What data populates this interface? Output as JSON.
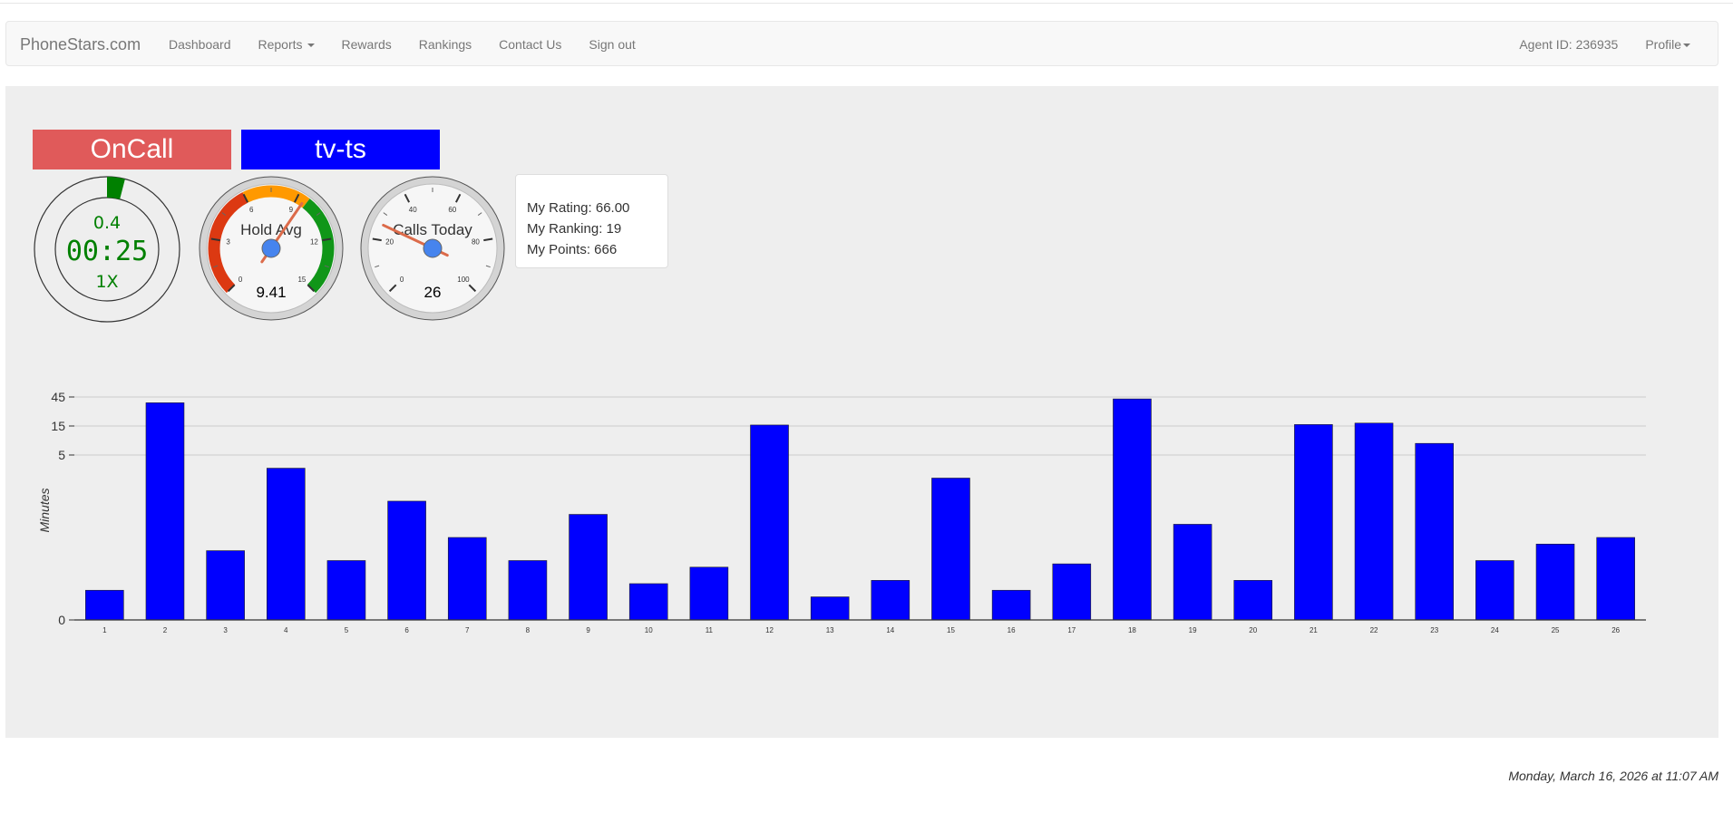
{
  "navbar": {
    "brand": "PhoneStars.com",
    "links": {
      "dashboard": "Dashboard",
      "reports": "Reports",
      "rewards": "Rewards",
      "rankings": "Rankings",
      "contact": "Contact Us",
      "signout": "Sign out"
    },
    "agent_id": "Agent ID: 236935",
    "profile": "Profile"
  },
  "status": {
    "state": "OnCall",
    "state_color": "#e05a5a",
    "campaign": "tv-ts",
    "campaign_color": "#0000ff"
  },
  "timer": {
    "top": "0.4",
    "time": "00:25",
    "multiplier": "1X",
    "progress_fraction": 0.04,
    "color": "#008000"
  },
  "hold_gauge": {
    "label": "Hold Avg",
    "value": 9.41,
    "value_text": "9.41",
    "min": 0,
    "max": 15,
    "ticks": [
      "0",
      "3",
      "6",
      "9",
      "12",
      "15"
    ]
  },
  "calls_gauge": {
    "label": "Calls Today",
    "value": 26,
    "value_text": "26",
    "min": 0,
    "max": 100,
    "ticks": [
      "0",
      "20",
      "40",
      "60",
      "80",
      "100"
    ]
  },
  "stats": {
    "rating": "My Rating: 66.00",
    "ranking": "My Ranking: 19",
    "points": "My Points: 666"
  },
  "chart_data": {
    "type": "bar",
    "ylabel": "Minutes",
    "y_ticks": [
      "0",
      "5",
      "15",
      "45"
    ],
    "categories": [
      "1",
      "2",
      "3",
      "4",
      "5",
      "6",
      "7",
      "8",
      "9",
      "10",
      "11",
      "12",
      "13",
      "14",
      "15",
      "16",
      "17",
      "18",
      "19",
      "20",
      "21",
      "22",
      "23",
      "24",
      "25",
      "26"
    ],
    "values": [
      0.9,
      39,
      2.1,
      4.6,
      1.8,
      3.6,
      2.5,
      1.8,
      3.2,
      1.1,
      1.6,
      16,
      0.7,
      1.2,
      4.3,
      0.9,
      1.7,
      43,
      2.9,
      1.2,
      16.5,
      18,
      9,
      1.8,
      2.3,
      2.5
    ],
    "bar_color": "#0000ff"
  },
  "footer": {
    "timestamp": "Monday, March 16, 2026 at 11:07 AM"
  }
}
